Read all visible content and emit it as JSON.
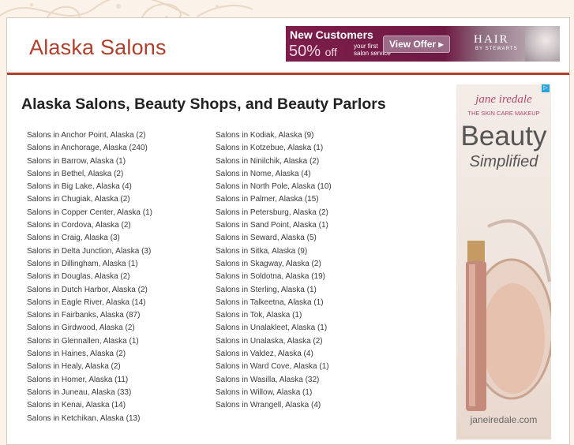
{
  "site": {
    "title": "Alaska Salons"
  },
  "banner_ad": {
    "headline": "New Customers",
    "discount": "50%",
    "discount_suffix": "off",
    "fine_print_1": "your first",
    "fine_print_2": "salon service",
    "offer_button": "View Offer ▸",
    "brand": "HAIR",
    "brand_sub": "BY STEWARTS"
  },
  "main": {
    "heading": "Alaska Salons, Beauty Shops, and Beauty Parlors",
    "column_1": [
      "Salons in Anchor Point, Alaska (2)",
      "Salons in Anchorage, Alaska (240)",
      "Salons in Barrow, Alaska (1)",
      "Salons in Bethel, Alaska (2)",
      "Salons in Big Lake, Alaska (4)",
      "Salons in Chugiak, Alaska (2)",
      "Salons in Copper Center, Alaska (1)",
      "Salons in Cordova, Alaska (2)",
      "Salons in Craig, Alaska (3)",
      "Salons in Delta Junction, Alaska (3)",
      "Salons in Dillingham, Alaska (1)",
      "Salons in Douglas, Alaska (2)",
      "Salons in Dutch Harbor, Alaska (2)",
      "Salons in Eagle River, Alaska (14)",
      "Salons in Fairbanks, Alaska (87)",
      "Salons in Girdwood, Alaska (2)",
      "Salons in Glennallen, Alaska (1)",
      "Salons in Haines, Alaska (2)",
      "Salons in Healy, Alaska (2)",
      "Salons in Homer, Alaska (11)",
      "Salons in Juneau, Alaska (33)",
      "Salons in Kenai, Alaska (14)",
      "Salons in Ketchikan, Alaska (13)"
    ],
    "column_2": [
      "Salons in Kodiak, Alaska (9)",
      "Salons in Kotzebue, Alaska (1)",
      "Salons in Ninilchik, Alaska (2)",
      "Salons in Nome, Alaska (4)",
      "Salons in North Pole, Alaska (10)",
      "Salons in Palmer, Alaska (15)",
      "Salons in Petersburg, Alaska (2)",
      "Salons in Sand Point, Alaska (1)",
      "Salons in Seward, Alaska (5)",
      "Salons in Sitka, Alaska (9)",
      "Salons in Skagway, Alaska (2)",
      "Salons in Soldotna, Alaska (19)",
      "Salons in Sterling, Alaska (1)",
      "Salons in Talkeetna, Alaska (1)",
      "Salons in Tok, Alaska (1)",
      "Salons in Unalakleet, Alaska (1)",
      "Salons in Unalaska, Alaska (2)",
      "Salons in Valdez, Alaska (4)",
      "Salons in Ward Cove, Alaska (1)",
      "Salons in Wasilla, Alaska (32)",
      "Salons in Willow, Alaska (1)",
      "Salons in Wrangell, Alaska (4)"
    ]
  },
  "side_ad": {
    "brand": "jane iredale",
    "tagline": "THE SKIN CARE MAKEUP",
    "headline_1": "Beauty",
    "headline_2": "Simplified",
    "url": "janeiredale.com"
  },
  "colors": {
    "accent": "#b0402c",
    "background": "#fbf3ea",
    "ad_purple": "#7d1d4a"
  }
}
